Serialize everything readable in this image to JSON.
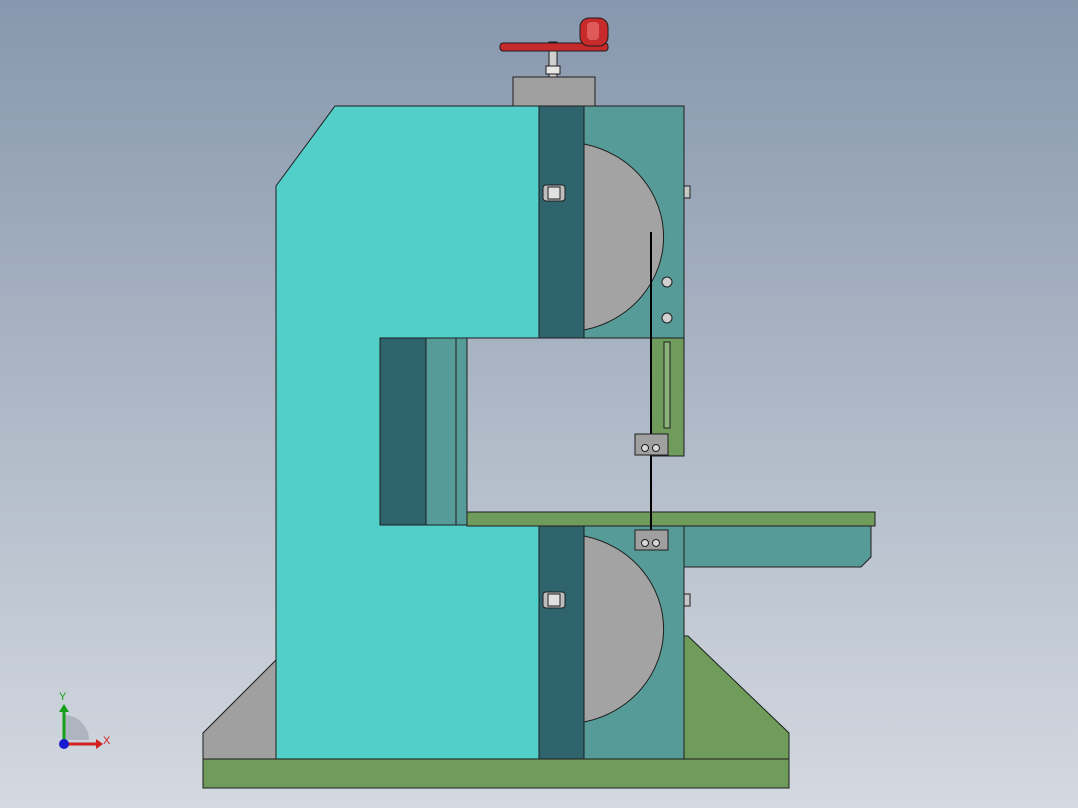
{
  "viewport": {
    "background_top": "#8797ad",
    "background_bottom": "#d4d9e0",
    "model": {
      "colors": {
        "frame": "#51cfc8",
        "frame_dark": "#2f646d",
        "frame_mid": "#579b98",
        "wheel": "#a3a3a3",
        "base": "#6f9b5b",
        "gray_block": "#a0a0a0",
        "crank": "#c72a2a",
        "outline": "#1e1e1e"
      }
    },
    "triad": {
      "x_label": "X",
      "y_label": "Y",
      "x_color": "#d42020",
      "y_color": "#18a018",
      "z_color": "#1a1ad0"
    }
  }
}
